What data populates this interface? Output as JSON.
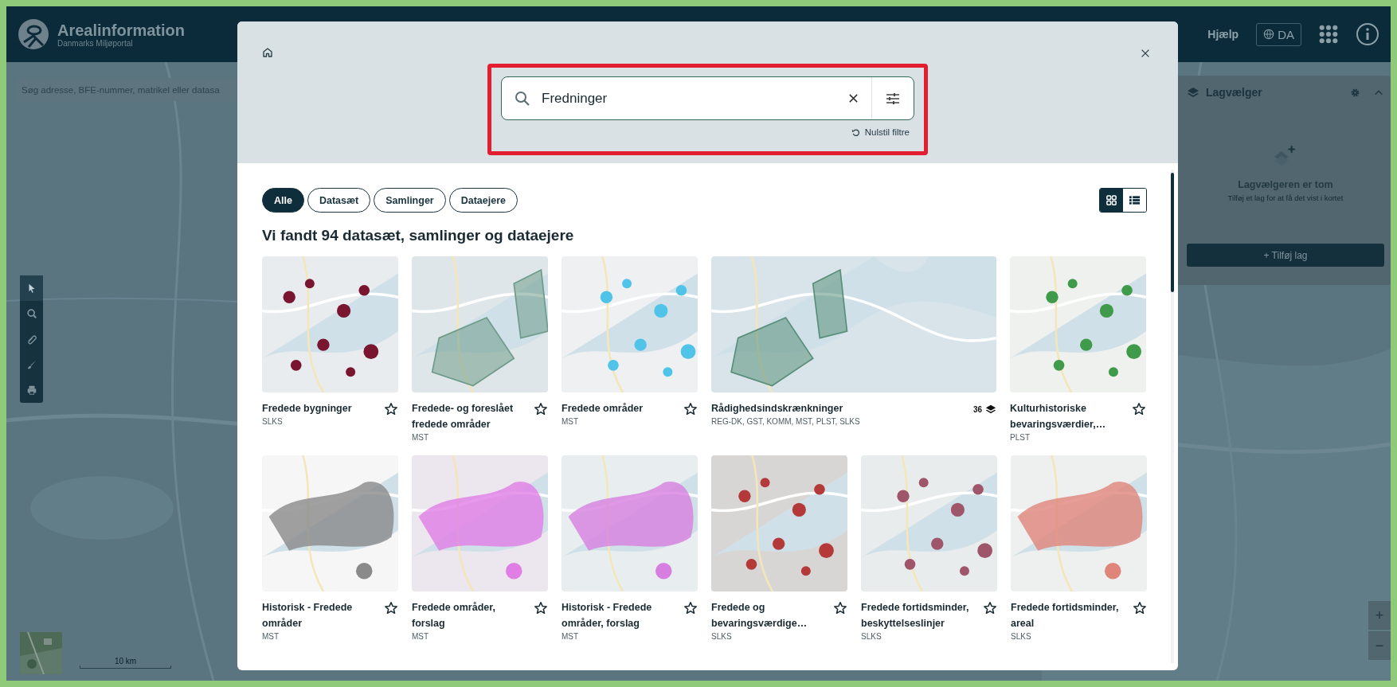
{
  "header": {
    "title": "Arealinformation",
    "subtitle": "Danmarks Miljøportal",
    "help": "Hjælp",
    "language": "DA"
  },
  "map_search": {
    "placeholder": "Søg adresse, BFE-nummer, matrikel eller datasa"
  },
  "layer_panel": {
    "title": "Lagvælger",
    "empty_title": "Lagvælgeren er tom",
    "empty_text": "Tilføj et lag for at få det vist i kortet",
    "add_button": "+ Tilføj lag"
  },
  "map_tools": [
    {
      "kind": "pointer",
      "selected": true
    },
    {
      "kind": "zoom",
      "selected": false
    },
    {
      "kind": "measure",
      "selected": false
    },
    {
      "kind": "draw",
      "selected": false
    },
    {
      "kind": "print",
      "selected": false
    }
  ],
  "scale": "10 km",
  "zoom_buttons": [
    "+",
    "−"
  ],
  "search_dialog": {
    "query": "Fredninger",
    "reset": "Nulstil filtre",
    "filters": [
      {
        "label": "Alle",
        "selected": true
      },
      {
        "label": "Datasæt",
        "selected": false
      },
      {
        "label": "Samlinger",
        "selected": false
      },
      {
        "label": "Dataejere",
        "selected": false
      }
    ],
    "views": [
      {
        "kind": "grid",
        "selected": true
      },
      {
        "kind": "list",
        "selected": false
      }
    ],
    "heading": "Vi fandt 94 datasæt, samlinger og dataejere",
    "result_rows": [
      [
        {
          "kind": "dataset",
          "title": "Fredede bygninger",
          "owner": "SLKS"
        },
        {
          "kind": "dataset",
          "title": "Fredede- og foreslået fredede områder",
          "owner": "MST"
        },
        {
          "kind": "dataset",
          "title": "Fredede områder",
          "owner": "MST"
        },
        {
          "kind": "collection",
          "title": "Rådighedsindskrænkninger",
          "owner": "REG-DK, GST, KOMM, MST, PLST, SLKS",
          "count": "36"
        },
        {
          "kind": "dataset",
          "title": "Kulturhistoriske bevaringsværdier,…",
          "owner": "PLST"
        }
      ],
      [
        {
          "kind": "dataset",
          "title": "Historisk - Fredede områder",
          "owner": "MST"
        },
        {
          "kind": "dataset",
          "title": "Fredede områder, forslag",
          "owner": "MST"
        },
        {
          "kind": "dataset",
          "title": "Historisk - Fredede områder, forslag",
          "owner": "MST"
        },
        {
          "kind": "dataset",
          "title": "Fredede og bevaringsværdige…",
          "owner": "SLKS"
        },
        {
          "kind": "dataset",
          "title": "Fredede fortidsminder, beskyttelseslinjer",
          "owner": "SLKS"
        },
        {
          "kind": "dataset",
          "title": "Fredede fortidsminder, areal",
          "owner": "SLKS"
        }
      ]
    ]
  }
}
